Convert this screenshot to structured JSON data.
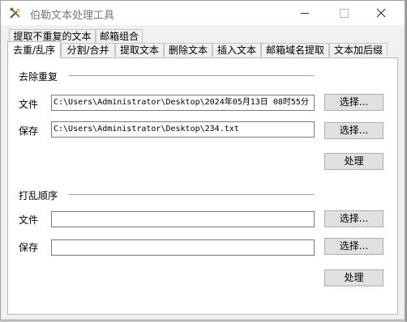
{
  "window": {
    "title": "伯勒文本处理工具"
  },
  "tabs_row1": [
    {
      "label": "提取不重复的文本"
    },
    {
      "label": "邮箱组合"
    }
  ],
  "tabs_row2": [
    {
      "label": "去重/乱序",
      "active": true
    },
    {
      "label": "分割/合并"
    },
    {
      "label": "提取文本"
    },
    {
      "label": "删除文本"
    },
    {
      "label": "插入文本"
    },
    {
      "label": "邮箱域名提取"
    },
    {
      "label": "文本加后缀"
    }
  ],
  "dedupe": {
    "title": "去除重复",
    "file_label": "文件",
    "file_value": "C:\\Users\\Administrator\\Desktop\\2024年05月13日 08时55分",
    "file_button": "选择...",
    "save_label": "保存",
    "save_value": "C:\\Users\\Administrator\\Desktop\\234.txt",
    "save_button": "选择...",
    "process_button": "处理"
  },
  "shuffle": {
    "title": "打乱顺序",
    "file_label": "文件",
    "file_value": "",
    "file_button": "选择...",
    "save_label": "保存",
    "save_value": "",
    "save_button": "选择...",
    "process_button": "处理"
  },
  "colors": {
    "window_bg": "#f0f0f0",
    "panel_bg": "#ffffff",
    "button_bg": "#e1e1e1"
  }
}
